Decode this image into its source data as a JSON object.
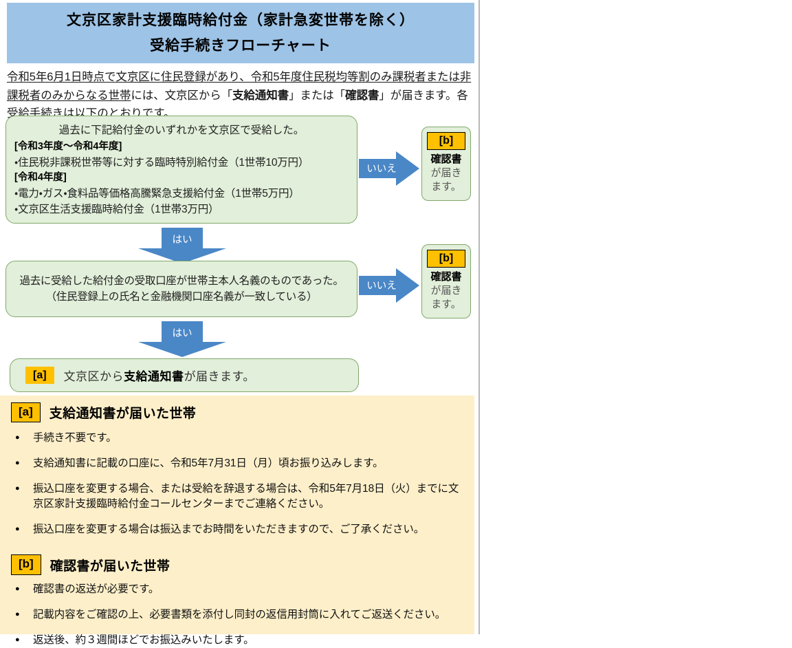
{
  "header": {
    "line1": "文京区家計支援臨時給付金（家計急変世帯を除く）",
    "line2": "受給手続きフローチャート",
    "bg_color": "#9DC3E6"
  },
  "intro": {
    "underlined": "令和5年6月1日時点で文京区に住民登録があり、令和5年度住民税均等割のみ課税者または非課税者のみからなる世帯",
    "rest_a": "には、文京区から「",
    "bold_a": "支給通知書",
    "rest_b": "」または「",
    "bold_b": "確認",
    "rest_c": "書",
    "rest_d": "」が届きます。各受給手続きは以下のとおりです。"
  },
  "flow": {
    "decision1": {
      "question": "過去に下記給付金のいずれかを文京区で受給した。",
      "group1_header": "[令和3年度〜令和4年度]",
      "group1_items": [
        "・住民税非課税世帯等に対する臨時特別給付金（1世帯10万円）"
      ],
      "group2_header": "[令和4年度]",
      "group2_items": [
        "・電力・ガス・食料品等価格高騰緊急支援給付金（1世帯5万円）",
        "・文京区生活支援臨時給付金（1世帯3万円）"
      ]
    },
    "decision2": {
      "line1": "過去に受給した給付金の受取口座が世帯主本人名義のものであった。",
      "line2": "（住民登録上の氏名と金融機関口座名義が一致している）"
    },
    "arrow_no_label": "いいえ",
    "arrow_yes_label": "はい",
    "arrow_color": "#4A87C7",
    "outcome_b_1": {
      "badge": "[b]",
      "line1": "確認書",
      "line2": "が届き",
      "line3": "ます。"
    },
    "outcome_b_2": {
      "badge": "[b]",
      "line1": "確認書",
      "line2": "が届き",
      "line3": "ます。"
    },
    "outcome_a": {
      "badge": "[a]",
      "text_pre": "文京区から",
      "text_bold": "支給通知書",
      "text_post": "が届きます。"
    },
    "box_fill": "#E2EFDA",
    "box_border": "#7FA86B",
    "badge_color": "#FFC000"
  },
  "sections": [
    {
      "badge": "[a]",
      "title": "支給通知書が届いた世帯",
      "items": [
        "手続き不要です。",
        "支給通知書に記載の口座に、令和5年7月31日（月）頃お振り込みします。",
        "振込口座を変更する場合、または受給を辞退する場合は、令和5年7月18日（火）までに文京区家計支援臨時給付金コールセンターまでご連絡ください。",
        "振込口座を変更する場合は振込までお時間をいただきますので、ご了承ください。"
      ]
    },
    {
      "badge": "[b]",
      "title": "確認書が届いた世帯",
      "items": [
        "確認書の返送が必要です。",
        "記載内容をご確認の上、必要書類を添付し同封の返信用封筒に入れてご返送ください。",
        "返送後、約３週間ほどでお振込みいたします。"
      ]
    }
  ],
  "page": {
    "cream_bg": "#FDEFC9"
  }
}
